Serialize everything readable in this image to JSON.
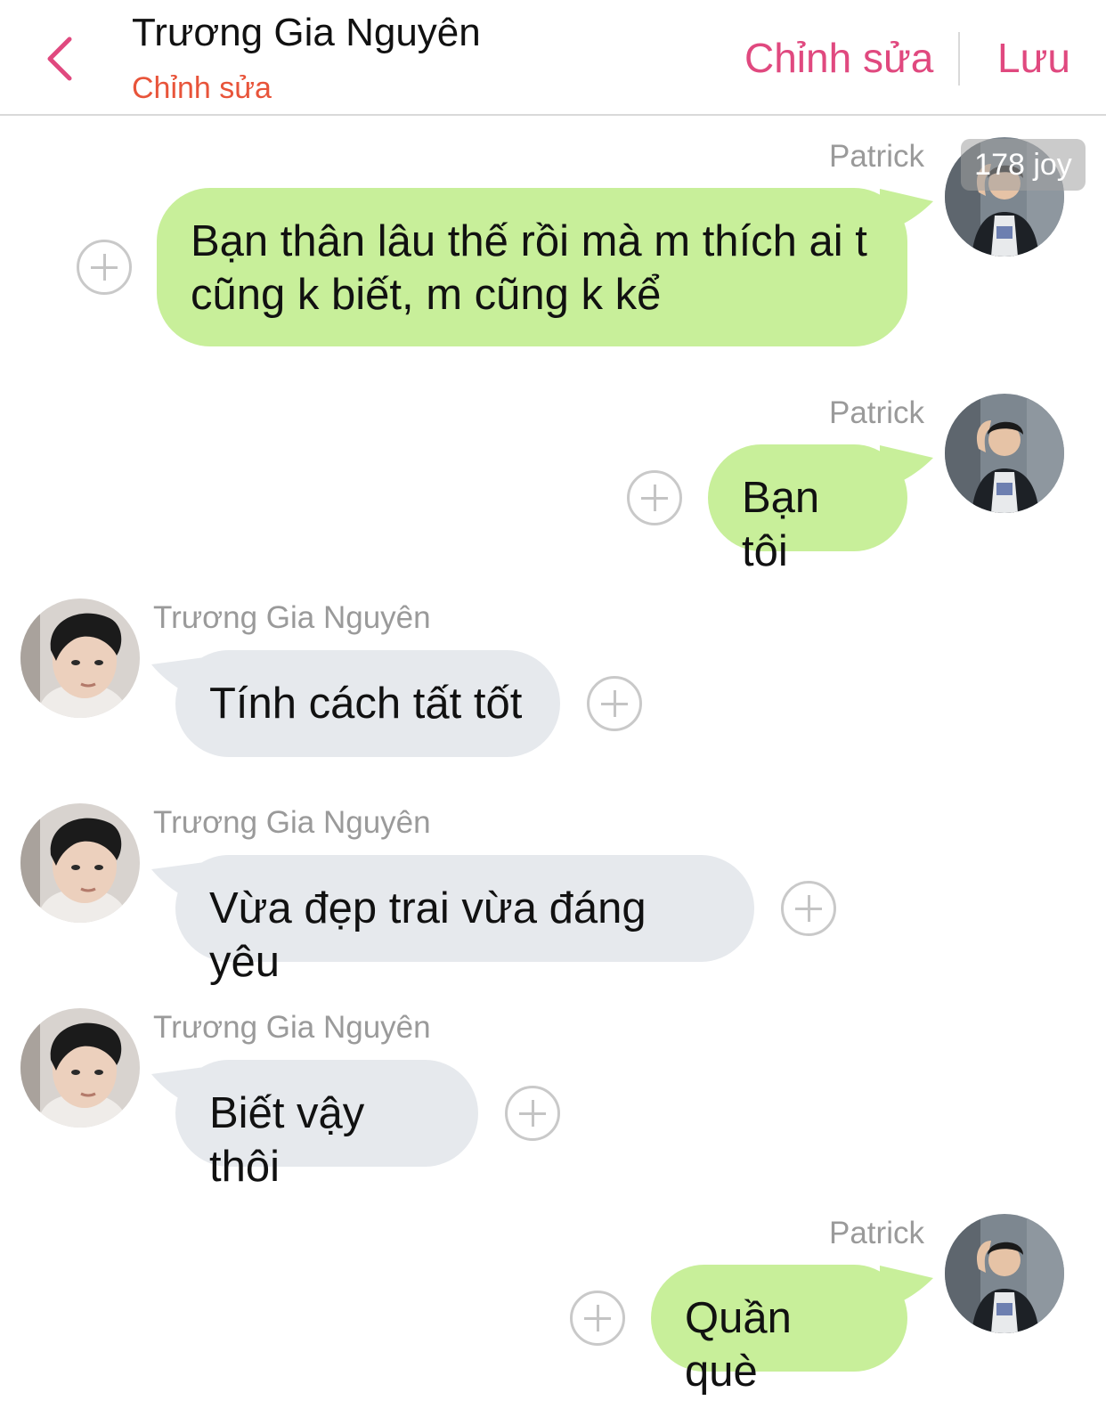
{
  "header": {
    "title": "Trương Gia Nguyên",
    "subtitle": "Chỉnh sửa",
    "edit_label": "Chỉnh sửa",
    "save_label": "Lưu",
    "accent": "#e0497f",
    "subtitle_color": "#e8543a"
  },
  "watermark": "178 joy",
  "messages": [
    {
      "sender": "Patrick",
      "side": "right",
      "text_lines": [
        "Bạn thân lâu thế rồi mà m thích ai t",
        "cũng k biết, m cũng k kể"
      ]
    },
    {
      "sender": "Patrick",
      "side": "right",
      "text": "Bạn tôi"
    },
    {
      "sender": "Trương Gia Nguyên",
      "side": "left",
      "text": "Tính cách tất tốt"
    },
    {
      "sender": "Trương Gia Nguyên",
      "side": "left",
      "text": "Vừa đẹp trai vừa đáng yêu"
    },
    {
      "sender": "Trương Gia Nguyên",
      "side": "left",
      "text": "Biết vậy thôi"
    },
    {
      "sender": "Patrick",
      "side": "right",
      "text": "Quần què"
    }
  ],
  "colors": {
    "outgoing_bubble": "#c8ef9a",
    "incoming_bubble": "#e6e9ed",
    "sender_name": "#9a9a9a"
  }
}
